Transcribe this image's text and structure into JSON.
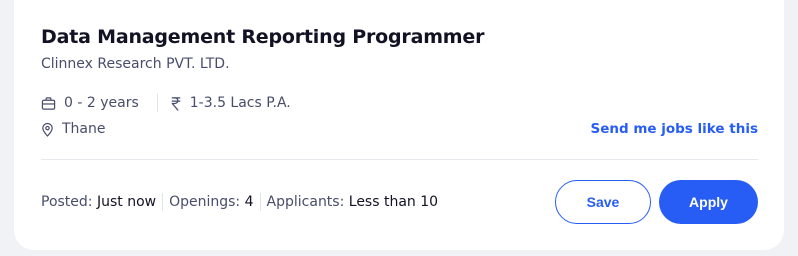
{
  "job": {
    "title": "Data Management Reporting Programmer",
    "company": "Clinnex Research PVT. LTD.",
    "experience": "0 - 2 years",
    "salary": "1-3.5 Lacs P.A.",
    "location": "Thane"
  },
  "links": {
    "send_similar": "Send me jobs like this"
  },
  "stats": {
    "posted_label": "Posted:",
    "posted_value": "Just now",
    "openings_label": "Openings:",
    "openings_value": "4",
    "applicants_label": "Applicants:",
    "applicants_value": "Less than 10"
  },
  "actions": {
    "save_label": "Save",
    "apply_label": "Apply"
  },
  "icons": {
    "experience": "briefcase-icon",
    "salary": "rupee-icon",
    "location": "location-pin-icon"
  },
  "colors": {
    "accent": "#275df5",
    "title": "#121224",
    "text": "#474d6a"
  }
}
